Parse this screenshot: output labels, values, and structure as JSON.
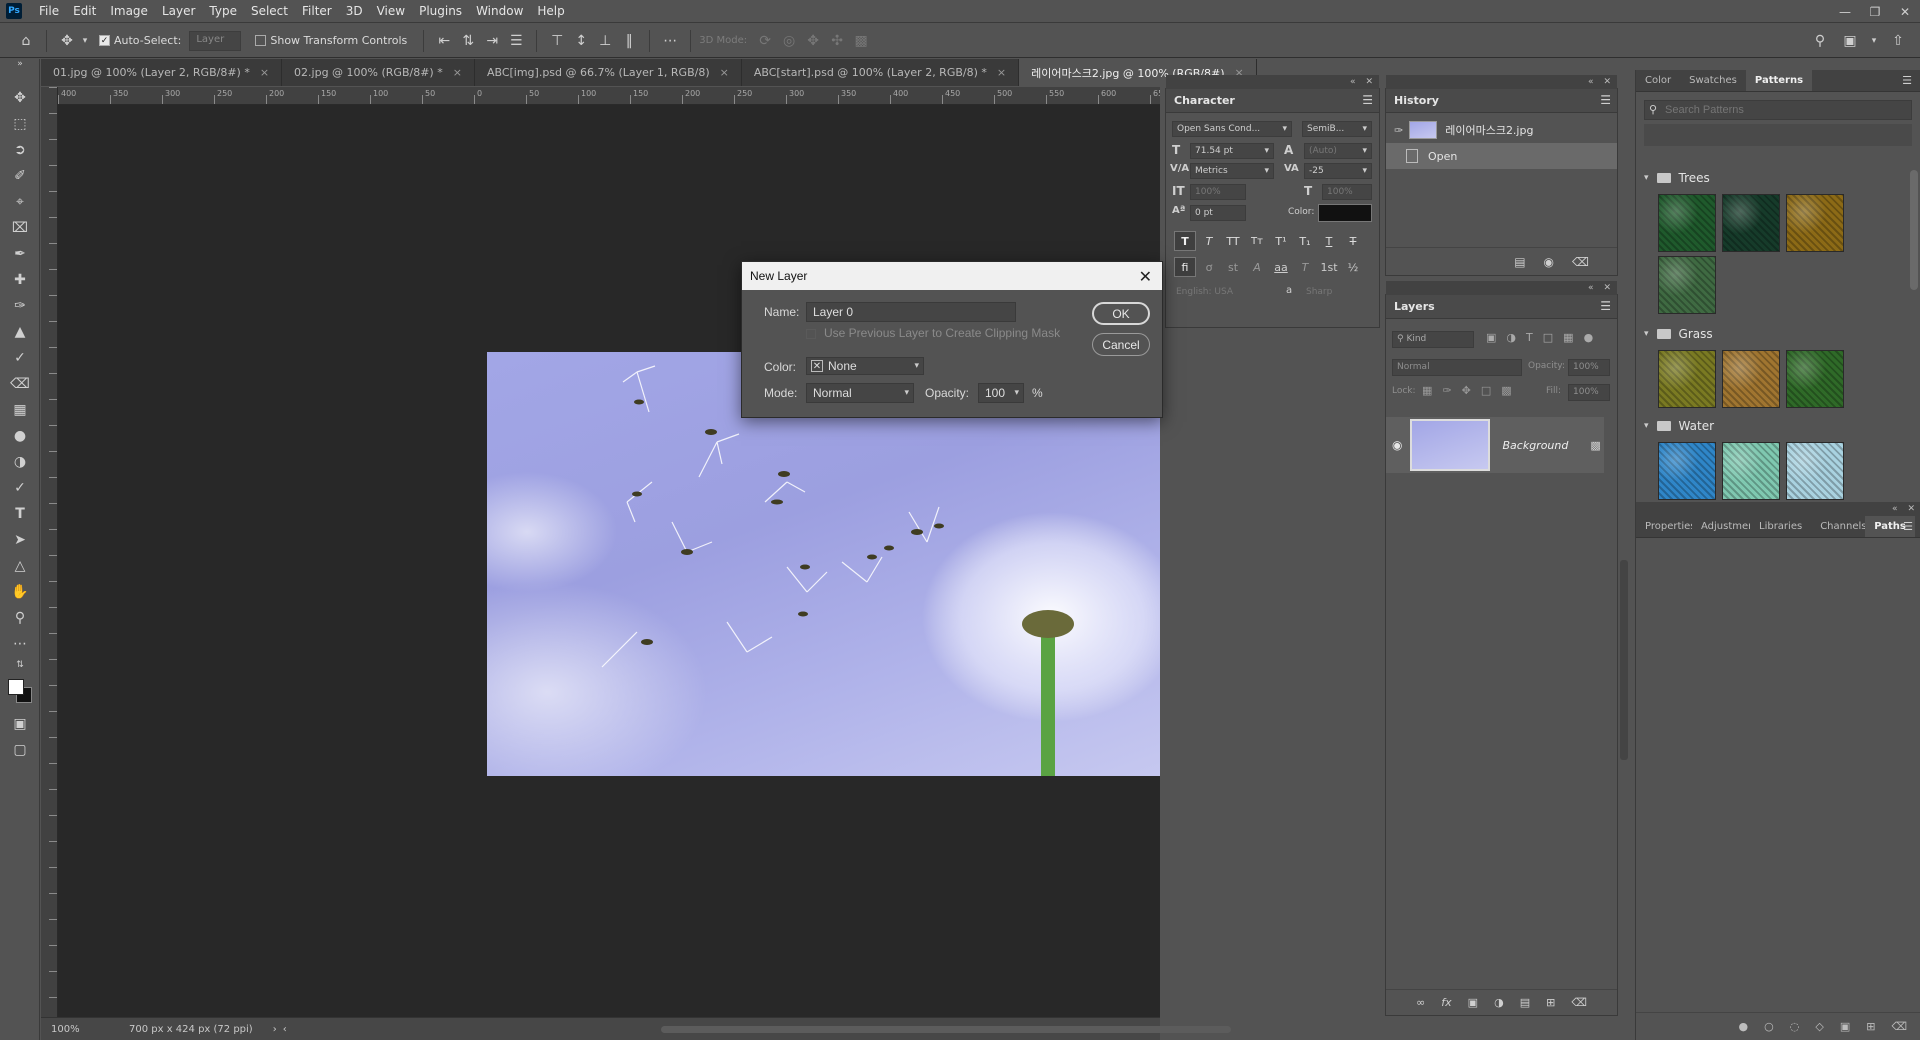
{
  "app": {
    "logo": "Ps"
  },
  "menubar": {
    "items": [
      "File",
      "Edit",
      "Image",
      "Layer",
      "Type",
      "Select",
      "Filter",
      "3D",
      "View",
      "Plugins",
      "Window",
      "Help"
    ]
  },
  "optionsbar": {
    "auto_select_label": "Auto-Select:",
    "auto_select_value": "Layer",
    "show_transform_label": "Show Transform Controls",
    "mode_3d_label": "3D Mode:"
  },
  "doc_tabs": [
    {
      "label": "01.jpg @ 100% (Layer 2, RGB/8#) *",
      "active": false
    },
    {
      "label": "02.jpg @ 100% (RGB/8#) *",
      "active": false
    },
    {
      "label": "ABC[img].psd @ 66.7% (Layer 1, RGB/8)",
      "active": false
    },
    {
      "label": "ABC[start].psd @ 100% (Layer 2, RGB/8) *",
      "active": false
    },
    {
      "label": "레이어마스크2.jpg @ 100% (RGB/8#)",
      "active": true
    }
  ],
  "ruler_h": [
    "400",
    "350",
    "300",
    "250",
    "200",
    "150",
    "100",
    "50",
    "0",
    "50",
    "100",
    "150",
    "200",
    "250",
    "300",
    "350",
    "400",
    "450",
    "500",
    "550",
    "600",
    "650"
  ],
  "status": {
    "zoom": "100%",
    "doc_info": "700 px x 424 px (72 ppi)"
  },
  "character": {
    "title": "Character",
    "font_family": "Open Sans Cond...",
    "font_style": "SemiB...",
    "size": "71.54 pt",
    "leading": "(Auto)",
    "kerning": "Metrics",
    "tracking": "-25",
    "vscale": "100%",
    "hscale": "100%",
    "baseline": "0 pt",
    "color_label": "Color:",
    "language": "English: USA",
    "aa_label": "a",
    "antialias": "Sharp"
  },
  "history": {
    "title": "History",
    "snapshot_label": "레이어마스크2.jpg",
    "steps": [
      {
        "label": "Open",
        "selected": true
      }
    ]
  },
  "layers": {
    "title": "Layers",
    "filter_label": "Kind",
    "blend_mode": "Normal",
    "opacity_label": "Opacity:",
    "opacity_value": "100%",
    "lock_label": "Lock:",
    "fill_label": "Fill:",
    "fill_value": "100%",
    "items": [
      {
        "name": "Background",
        "locked": true
      }
    ]
  },
  "right_tabs_top": [
    {
      "label": "Color",
      "active": false
    },
    {
      "label": "Swatches",
      "active": false
    },
    {
      "label": "Patterns",
      "active": true
    }
  ],
  "patterns": {
    "search_placeholder": "Search Patterns",
    "groups": [
      {
        "name": "Trees",
        "colors": [
          "#1f5a2c",
          "#163b2a",
          "#8c6a16",
          "#3f6a42"
        ]
      },
      {
        "name": "Grass",
        "colors": [
          "#7a7a22",
          "#a07530",
          "#2f6a28"
        ]
      },
      {
        "name": "Water",
        "colors": [
          "#2f86c8",
          "#7fc8b0",
          "#a9d2e0"
        ]
      }
    ]
  },
  "right_tabs_bottom": [
    {
      "label": "Properties",
      "active": false
    },
    {
      "label": "Adjustments",
      "active": false
    },
    {
      "label": "Libraries",
      "active": false
    },
    {
      "label": "Channels",
      "active": false
    },
    {
      "label": "Paths",
      "active": true
    }
  ],
  "dialog": {
    "title": "New Layer",
    "name_label": "Name:",
    "name_value": "Layer 0",
    "clip_label": "Use Previous Layer to Create Clipping Mask",
    "color_label": "Color:",
    "color_value": "None",
    "mode_label": "Mode:",
    "mode_value": "Normal",
    "opacity_label": "Opacity:",
    "opacity_value": "100",
    "percent": "%",
    "ok_label": "OK",
    "cancel_label": "Cancel"
  }
}
